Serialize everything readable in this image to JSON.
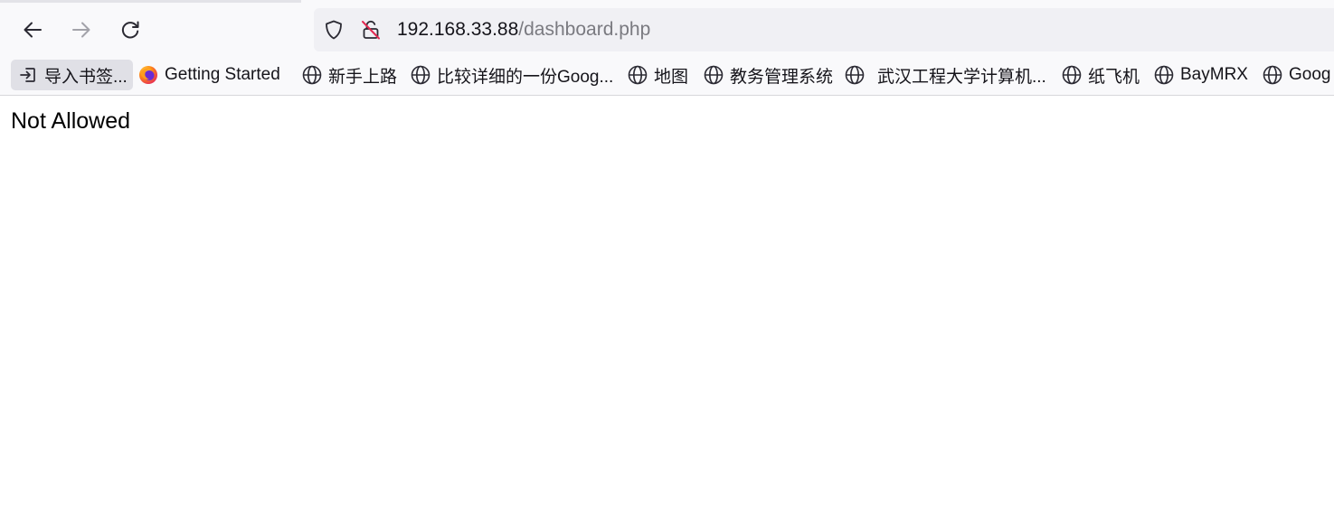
{
  "toolbar": {
    "back_icon": "arrow-left-icon",
    "forward_icon": "arrow-right-icon",
    "reload_icon": "reload-icon"
  },
  "urlbar": {
    "host": "192.168.33.88",
    "path": "/dashboard.php",
    "shield_icon": "shield-icon",
    "insecure_icon": "insecure-lock-icon"
  },
  "bookmarks": [
    {
      "label": "导入书签...",
      "icon": "import-icon"
    },
    {
      "label": "Getting Started",
      "icon": "firefox-icon"
    },
    {
      "label": "新手上路",
      "icon": "globe-icon"
    },
    {
      "label": "比较详细的一份Goog...",
      "icon": "globe-icon"
    },
    {
      "label": "地图",
      "icon": "globe-icon"
    },
    {
      "label": "教务管理系统",
      "icon": "globe-icon"
    },
    {
      "label": "武汉工程大学计算机...",
      "icon": "globe-icon"
    },
    {
      "label": "纸飞机",
      "icon": "globe-icon"
    },
    {
      "label": "BayMRX",
      "icon": "globe-icon"
    },
    {
      "label": "Goog",
      "icon": "globe-icon"
    }
  ],
  "page": {
    "message": "Not Allowed"
  },
  "colors": {
    "chrome_bg": "#f9f9fb",
    "urlbar_bg": "#f0f0f4",
    "insecure_slash": "#e22850"
  }
}
